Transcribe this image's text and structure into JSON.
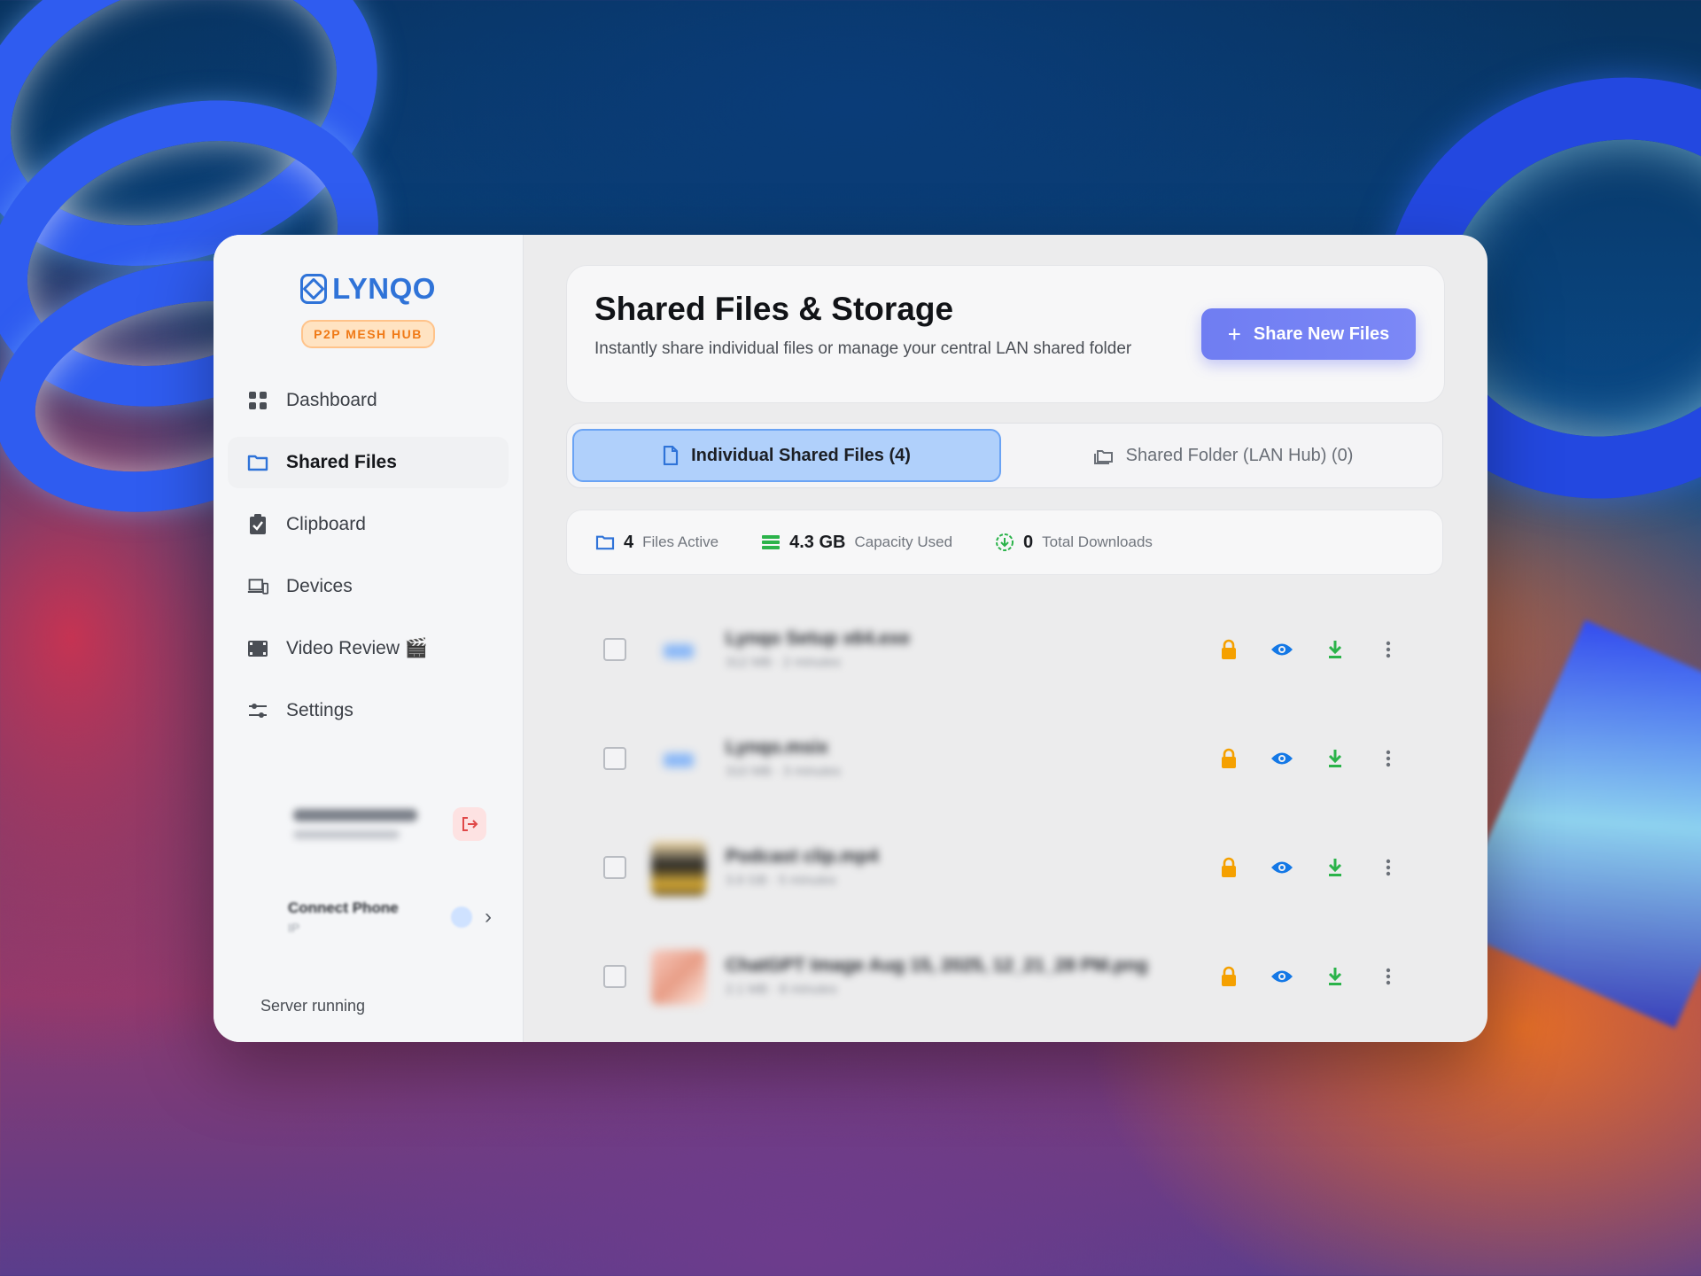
{
  "app": {
    "name": "LYNQO",
    "badge": "P2P MESH HUB",
    "accent": "#2f73d8",
    "badge_color": "#f07a17"
  },
  "sidebar": {
    "items": [
      {
        "label": "Dashboard",
        "icon": "grid-icon",
        "active": false
      },
      {
        "label": "Shared Files",
        "icon": "folder-icon",
        "active": true
      },
      {
        "label": "Clipboard",
        "icon": "clipboard-check-icon",
        "active": false
      },
      {
        "label": "Devices",
        "icon": "devices-icon",
        "active": false
      },
      {
        "label": "Video Review 🎬",
        "icon": "film-icon",
        "active": false
      },
      {
        "label": "Settings",
        "icon": "sliders-icon",
        "active": false
      }
    ],
    "connect": {
      "label": "Connect Phone",
      "ip_label": "IP"
    },
    "server_status": "Server running"
  },
  "header": {
    "title": "Shared Files & Storage",
    "subtitle": "Instantly share individual files or manage your central LAN shared folder",
    "share_button": "Share New Files",
    "share_button_color": "#7480f4"
  },
  "tabs": [
    {
      "label": "Individual Shared Files (4)",
      "icon": "file-icon",
      "active": true
    },
    {
      "label": "Shared Folder (LAN Hub) (0)",
      "icon": "folders-icon",
      "active": false
    }
  ],
  "stats": {
    "files": {
      "value": "4",
      "label": "Files Active",
      "icon": "folder-icon"
    },
    "capacity": {
      "value": "4.3 GB",
      "label": "Capacity Used",
      "icon": "storage-icon"
    },
    "downloads": {
      "value": "0",
      "label": "Total Downloads",
      "icon": "download-circle-icon"
    }
  },
  "files": [
    {
      "name": "Lynqo Setup x64.exe",
      "meta": "312 MB · 2 minutes",
      "thumb": "file"
    },
    {
      "name": "Lynqo.msix",
      "meta": "310 MB · 3 minutes",
      "thumb": "file"
    },
    {
      "name": "Podcast clip.mp4",
      "meta": "3.6 GB · 5 minutes",
      "thumb": "img1"
    },
    {
      "name": "ChatGPT Image Aug 15, 2025, 12_21_28 PM.png",
      "meta": "2.1 MB · 8 minutes",
      "thumb": "img2"
    }
  ],
  "row_action_colors": {
    "lock": "#f5a000",
    "view": "#1478e6",
    "download": "#2bb34a",
    "more": "#6b7078"
  }
}
